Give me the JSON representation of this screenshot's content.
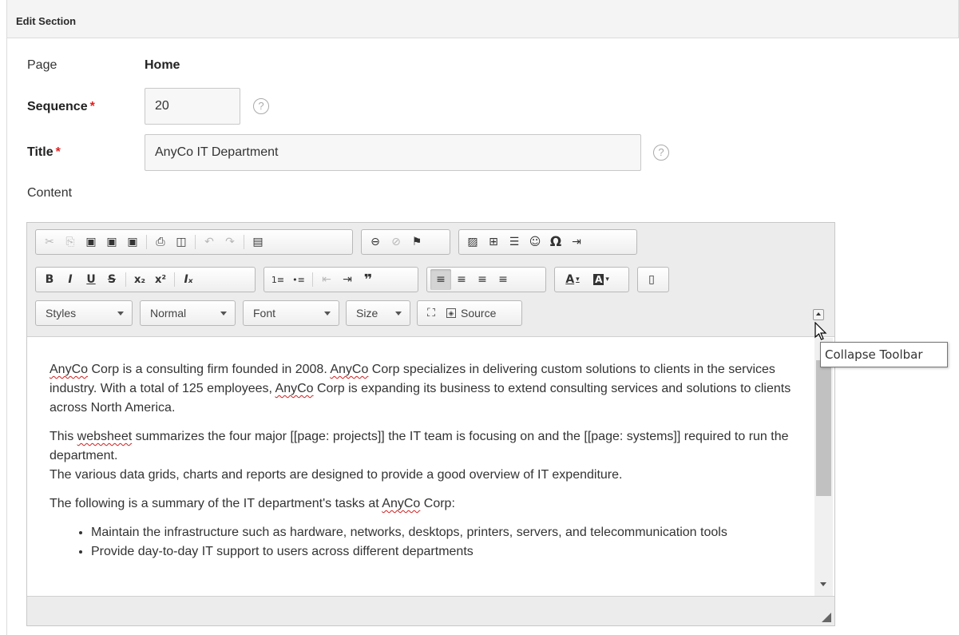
{
  "header": {
    "title": "Edit Section"
  },
  "form": {
    "page": {
      "label": "Page",
      "value": "Home"
    },
    "sequence": {
      "label": "Sequence",
      "required_mark": "*",
      "value": "20"
    },
    "title": {
      "label": "Title",
      "required_mark": "*",
      "value": "AnyCo IT Department"
    },
    "content": {
      "label": "Content"
    },
    "help_glyph": "?"
  },
  "editor": {
    "toolbar_row1": [
      {
        "name": "cut-icon",
        "glyph": "✂"
      },
      {
        "name": "copy-icon",
        "glyph": "⎘"
      },
      {
        "name": "paste-icon",
        "glyph": "📋"
      },
      {
        "name": "paste-text-icon",
        "glyph": "📋"
      },
      {
        "name": "paste-word-icon",
        "glyph": "📋"
      },
      {
        "name": "print-icon",
        "glyph": "⎙"
      },
      {
        "name": "preview-icon",
        "glyph": "🔍"
      },
      {
        "name": "undo-icon",
        "glyph": "↶"
      },
      {
        "name": "redo-icon",
        "glyph": "↷"
      },
      {
        "name": "templates-icon",
        "glyph": "▤"
      },
      {
        "name": "link-icon",
        "glyph": "🔗"
      },
      {
        "name": "unlink-icon",
        "glyph": "⛓"
      },
      {
        "name": "anchor-icon",
        "glyph": "⚑"
      },
      {
        "name": "image-icon",
        "glyph": "🖼"
      },
      {
        "name": "table-icon",
        "glyph": "⊞"
      },
      {
        "name": "horizontal-line-icon",
        "glyph": "☰"
      },
      {
        "name": "smiley-icon",
        "glyph": "☺"
      },
      {
        "name": "special-char-icon",
        "glyph": "Ω"
      },
      {
        "name": "page-break-icon",
        "glyph": "⇥"
      }
    ],
    "toolbar_row2": {
      "bold": "B",
      "italic": "I",
      "underline": "U",
      "strike": "S",
      "subscript": "x₂",
      "superscript": "x²",
      "remove_format": "Iₓ",
      "numbered_list": "1≡",
      "bulleted_list": "•≡",
      "outdent": "⇤",
      "indent": "⇥",
      "blockquote": "❞",
      "align_left": "≡",
      "align_center": "≡",
      "align_right": "≡",
      "justify": "≡",
      "text_color": "A",
      "bg_color": "A",
      "show_blocks": "▯"
    },
    "combos": {
      "styles": "Styles",
      "format": "Normal",
      "font": "Font",
      "size": "Size"
    },
    "maximize_glyph": "⛶",
    "source_label": "Source",
    "tooltip": "Collapse Toolbar",
    "content": {
      "p1_a": "AnyCo",
      "p1_b": " Corp is a consulting firm founded in 2008. ",
      "p1_c": "AnyCo",
      "p1_d": " Corp specializes in delivering custom solutions to clients in the services industry. With a total of 125 employees, ",
      "p1_e": "AnyCo",
      "p1_f": " Corp is expanding its business to extend consulting services and solutions to clients across North America.",
      "p2_a": "This ",
      "p2_b": "websheet",
      "p2_c": " summarizes the four major [[page: projects]] the IT team is focusing on and the [[page: systems]] required to run the department.",
      "p2_line2": "The various data grids, charts and reports are designed to provide a good overview of IT expenditure.",
      "p3_a": "The following is a summary of the IT department's tasks at ",
      "p3_b": "AnyCo",
      "p3_c": " Corp:",
      "bullet1": "Maintain the infrastructure such as hardware, networks, desktops, printers, servers, and telecommunication tools",
      "bullet2": "Provide day-to-day IT support to users across different departments"
    }
  }
}
